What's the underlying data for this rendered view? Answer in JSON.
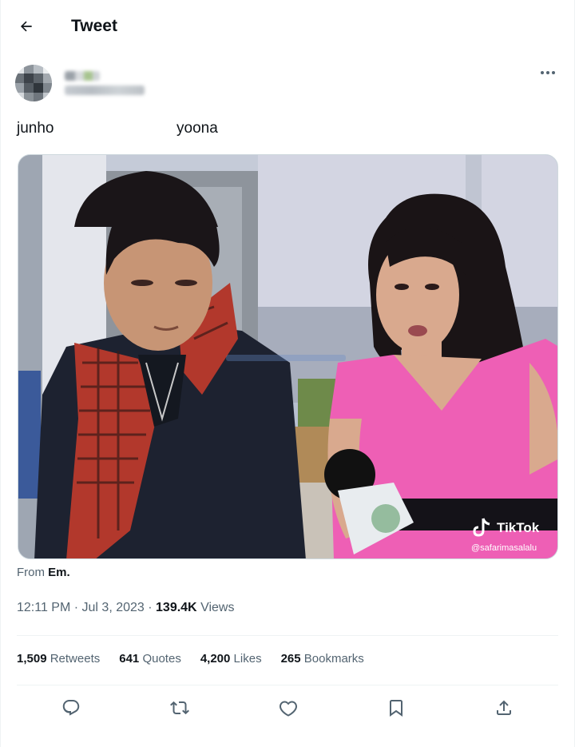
{
  "header": {
    "title": "Tweet"
  },
  "author": {
    "name_hidden": true
  },
  "tweet": {
    "text_left": "junho",
    "text_right": "yoona",
    "media": {
      "watermark_brand": "TikTok",
      "watermark_handle": "@safarimasalalu"
    },
    "from_label": "From",
    "from_name": "Em.",
    "time": "12:11 PM · Jul 3, 2023 · ",
    "views_count": "139.4K",
    "views_label": "Views"
  },
  "stats": [
    {
      "count": "1,509",
      "label": "Retweets"
    },
    {
      "count": "641",
      "label": "Quotes"
    },
    {
      "count": "4,200",
      "label": "Likes"
    },
    {
      "count": "265",
      "label": "Bookmarks"
    }
  ],
  "icons": {
    "back": "back-arrow-icon",
    "more": "more-dots-icon",
    "reply": "reply-icon",
    "retweet": "retweet-icon",
    "like": "heart-icon",
    "bookmark": "bookmark-icon",
    "share": "share-icon"
  },
  "colors": {
    "text_primary": "#0f1419",
    "text_secondary": "#536471",
    "divider": "#eff3f4"
  }
}
